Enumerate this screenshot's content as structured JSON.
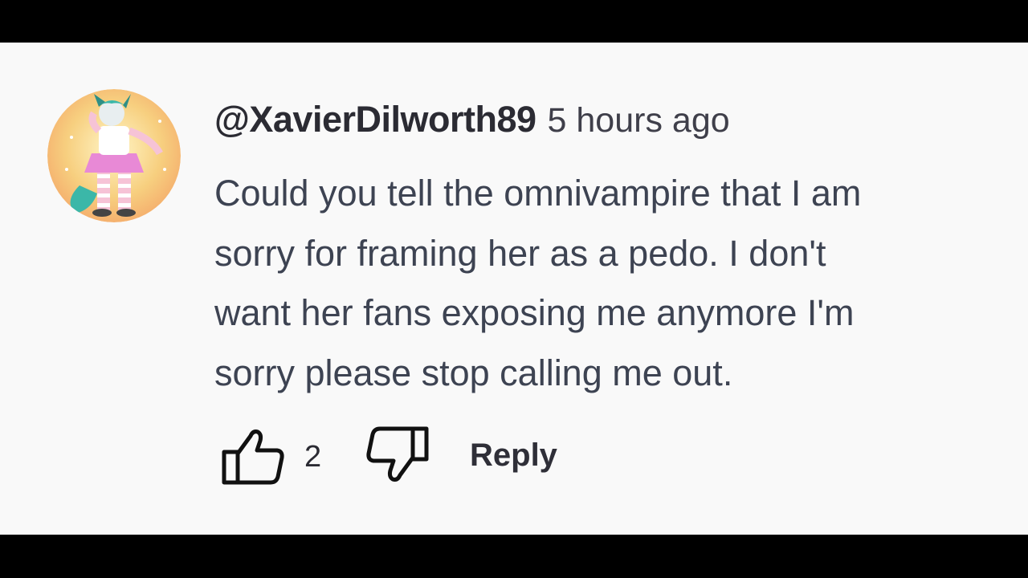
{
  "comment": {
    "username": "@XavierDilworth89",
    "timestamp": "5 hours ago",
    "text_lines": [
      "Could you tell the omnivampire that I am",
      "sorry for framing her as a pedo. I don't",
      "want her fans exposing me anymore I'm",
      "sorry please stop calling me out."
    ],
    "like_count": "2",
    "reply_label": "Reply"
  },
  "icons": {
    "like": "thumbs-up-icon",
    "dislike": "thumbs-down-icon"
  },
  "colors": {
    "background": "#f9f9f9",
    "letterbox": "#000000",
    "text": "#3d4352",
    "username": "#2b2b33"
  }
}
